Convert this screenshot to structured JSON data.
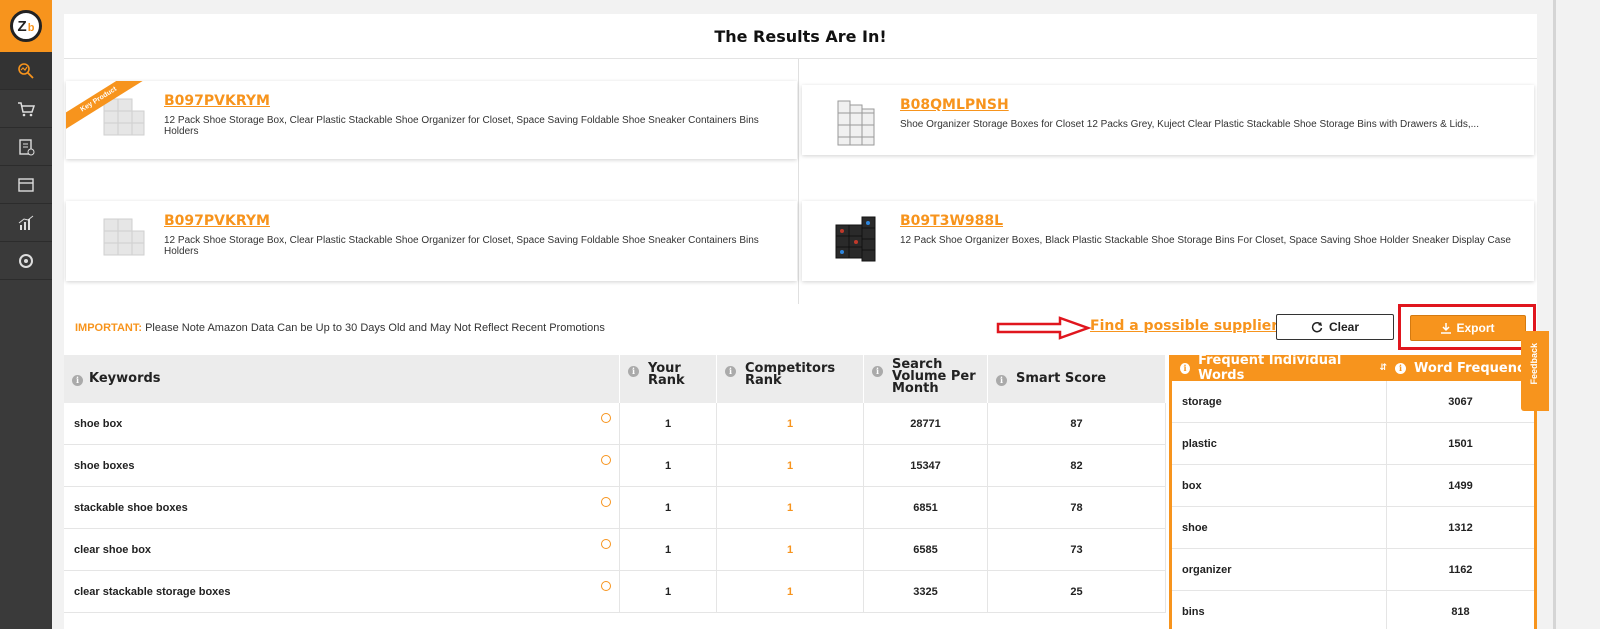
{
  "sidebar": {
    "logo": {
      "letter": "Z",
      "sub": "b"
    },
    "items": [
      "keyword-search-icon",
      "cart-icon",
      "clipboard-check-icon",
      "calendar-icon",
      "analytics-icon",
      "settings-icon"
    ]
  },
  "header": {
    "title": "The Results Are In!"
  },
  "products": [
    {
      "asin": "B097PVKRYM",
      "title": "12 Pack Shoe Storage Box, Clear Plastic Stackable Shoe Organizer for Closet, Space Saving Foldable Shoe Sneaker Containers Bins Holders",
      "badge": "Key Product",
      "image": "clear-shoe-boxes"
    },
    {
      "asin": "B08QMLPNSH",
      "title": "Shoe Organizer Storage Boxes for Closet 12 Packs Grey, Kuject Clear Plastic Stackable Shoe Storage Bins with Drawers & Lids,...",
      "image": "grey-shoe-boxes"
    },
    {
      "asin": "B097PVKRYM",
      "title": "12 Pack Shoe Storage Box, Clear Plastic Stackable Shoe Organizer for Closet, Space Saving Foldable Shoe Sneaker Containers Bins Holders",
      "image": "clear-shoe-boxes"
    },
    {
      "asin": "B09T3W988L",
      "title": "12 Pack Shoe Organizer Boxes, Black Plastic Stackable Shoe Storage Bins For Closet, Space Saving Shoe Holder Sneaker Display Case",
      "image": "black-shoe-boxes"
    }
  ],
  "notice": {
    "label": "IMPORTANT:",
    "text": " Please Note Amazon Data Can be Up to 30 Days Old and May Not Reflect Recent Promotions"
  },
  "actions": {
    "supplier_link": "Find a possible supplier",
    "clear": "Clear",
    "export": "Export"
  },
  "keywords_table": {
    "headers": [
      "Keywords",
      "Your Rank",
      "Competitors Rank",
      "Search Volume Per Month",
      "Smart Score"
    ],
    "rows": [
      {
        "keyword": "shoe box",
        "your_rank": "1",
        "competitors_rank": "1",
        "search_volume": "28771",
        "smart_score": "87"
      },
      {
        "keyword": "shoe boxes",
        "your_rank": "1",
        "competitors_rank": "1",
        "search_volume": "15347",
        "smart_score": "82"
      },
      {
        "keyword": "stackable shoe boxes",
        "your_rank": "1",
        "competitors_rank": "1",
        "search_volume": "6851",
        "smart_score": "78"
      },
      {
        "keyword": "clear shoe box",
        "your_rank": "1",
        "competitors_rank": "1",
        "search_volume": "6585",
        "smart_score": "73"
      },
      {
        "keyword": "clear stackable storage boxes",
        "your_rank": "1",
        "competitors_rank": "1",
        "search_volume": "3325",
        "smart_score": "25"
      }
    ]
  },
  "frequency_table": {
    "headers": [
      "Frequent Individual Words",
      "Word Frequency"
    ],
    "rows": [
      {
        "word": "storage",
        "frequency": "3067"
      },
      {
        "word": "plastic",
        "frequency": "1501"
      },
      {
        "word": "box",
        "frequency": "1499"
      },
      {
        "word": "shoe",
        "frequency": "1312"
      },
      {
        "word": "organizer",
        "frequency": "1162"
      },
      {
        "word": "bins",
        "frequency": "818"
      }
    ]
  },
  "feedback": {
    "label": "Feedback"
  },
  "colors": {
    "accent": "#f7941d",
    "sidebar": "#3a3a3a",
    "highlight": "#e0161e"
  }
}
